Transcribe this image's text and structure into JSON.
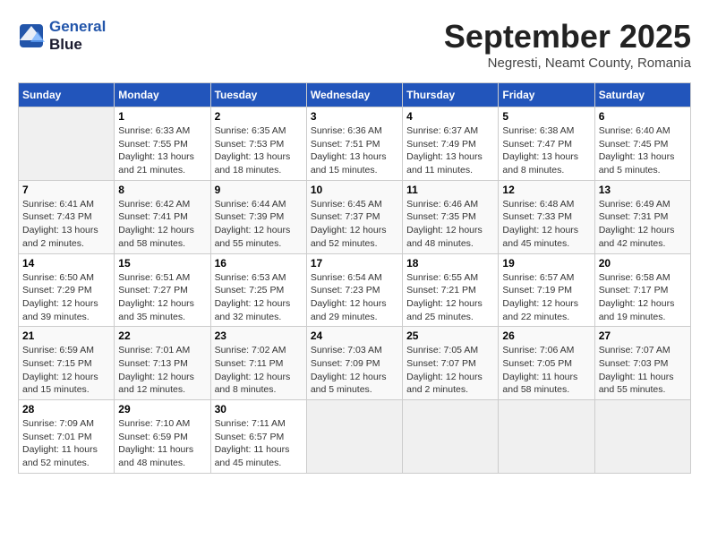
{
  "header": {
    "logo_line1": "General",
    "logo_line2": "Blue",
    "month_title": "September 2025",
    "location": "Negresti, Neamt County, Romania"
  },
  "weekdays": [
    "Sunday",
    "Monday",
    "Tuesday",
    "Wednesday",
    "Thursday",
    "Friday",
    "Saturday"
  ],
  "weeks": [
    [
      {
        "day": "",
        "sunrise": "",
        "sunset": "",
        "daylight": ""
      },
      {
        "day": "1",
        "sunrise": "Sunrise: 6:33 AM",
        "sunset": "Sunset: 7:55 PM",
        "daylight": "Daylight: 13 hours and 21 minutes."
      },
      {
        "day": "2",
        "sunrise": "Sunrise: 6:35 AM",
        "sunset": "Sunset: 7:53 PM",
        "daylight": "Daylight: 13 hours and 18 minutes."
      },
      {
        "day": "3",
        "sunrise": "Sunrise: 6:36 AM",
        "sunset": "Sunset: 7:51 PM",
        "daylight": "Daylight: 13 hours and 15 minutes."
      },
      {
        "day": "4",
        "sunrise": "Sunrise: 6:37 AM",
        "sunset": "Sunset: 7:49 PM",
        "daylight": "Daylight: 13 hours and 11 minutes."
      },
      {
        "day": "5",
        "sunrise": "Sunrise: 6:38 AM",
        "sunset": "Sunset: 7:47 PM",
        "daylight": "Daylight: 13 hours and 8 minutes."
      },
      {
        "day": "6",
        "sunrise": "Sunrise: 6:40 AM",
        "sunset": "Sunset: 7:45 PM",
        "daylight": "Daylight: 13 hours and 5 minutes."
      }
    ],
    [
      {
        "day": "7",
        "sunrise": "Sunrise: 6:41 AM",
        "sunset": "Sunset: 7:43 PM",
        "daylight": "Daylight: 13 hours and 2 minutes."
      },
      {
        "day": "8",
        "sunrise": "Sunrise: 6:42 AM",
        "sunset": "Sunset: 7:41 PM",
        "daylight": "Daylight: 12 hours and 58 minutes."
      },
      {
        "day": "9",
        "sunrise": "Sunrise: 6:44 AM",
        "sunset": "Sunset: 7:39 PM",
        "daylight": "Daylight: 12 hours and 55 minutes."
      },
      {
        "day": "10",
        "sunrise": "Sunrise: 6:45 AM",
        "sunset": "Sunset: 7:37 PM",
        "daylight": "Daylight: 12 hours and 52 minutes."
      },
      {
        "day": "11",
        "sunrise": "Sunrise: 6:46 AM",
        "sunset": "Sunset: 7:35 PM",
        "daylight": "Daylight: 12 hours and 48 minutes."
      },
      {
        "day": "12",
        "sunrise": "Sunrise: 6:48 AM",
        "sunset": "Sunset: 7:33 PM",
        "daylight": "Daylight: 12 hours and 45 minutes."
      },
      {
        "day": "13",
        "sunrise": "Sunrise: 6:49 AM",
        "sunset": "Sunset: 7:31 PM",
        "daylight": "Daylight: 12 hours and 42 minutes."
      }
    ],
    [
      {
        "day": "14",
        "sunrise": "Sunrise: 6:50 AM",
        "sunset": "Sunset: 7:29 PM",
        "daylight": "Daylight: 12 hours and 39 minutes."
      },
      {
        "day": "15",
        "sunrise": "Sunrise: 6:51 AM",
        "sunset": "Sunset: 7:27 PM",
        "daylight": "Daylight: 12 hours and 35 minutes."
      },
      {
        "day": "16",
        "sunrise": "Sunrise: 6:53 AM",
        "sunset": "Sunset: 7:25 PM",
        "daylight": "Daylight: 12 hours and 32 minutes."
      },
      {
        "day": "17",
        "sunrise": "Sunrise: 6:54 AM",
        "sunset": "Sunset: 7:23 PM",
        "daylight": "Daylight: 12 hours and 29 minutes."
      },
      {
        "day": "18",
        "sunrise": "Sunrise: 6:55 AM",
        "sunset": "Sunset: 7:21 PM",
        "daylight": "Daylight: 12 hours and 25 minutes."
      },
      {
        "day": "19",
        "sunrise": "Sunrise: 6:57 AM",
        "sunset": "Sunset: 7:19 PM",
        "daylight": "Daylight: 12 hours and 22 minutes."
      },
      {
        "day": "20",
        "sunrise": "Sunrise: 6:58 AM",
        "sunset": "Sunset: 7:17 PM",
        "daylight": "Daylight: 12 hours and 19 minutes."
      }
    ],
    [
      {
        "day": "21",
        "sunrise": "Sunrise: 6:59 AM",
        "sunset": "Sunset: 7:15 PM",
        "daylight": "Daylight: 12 hours and 15 minutes."
      },
      {
        "day": "22",
        "sunrise": "Sunrise: 7:01 AM",
        "sunset": "Sunset: 7:13 PM",
        "daylight": "Daylight: 12 hours and 12 minutes."
      },
      {
        "day": "23",
        "sunrise": "Sunrise: 7:02 AM",
        "sunset": "Sunset: 7:11 PM",
        "daylight": "Daylight: 12 hours and 8 minutes."
      },
      {
        "day": "24",
        "sunrise": "Sunrise: 7:03 AM",
        "sunset": "Sunset: 7:09 PM",
        "daylight": "Daylight: 12 hours and 5 minutes."
      },
      {
        "day": "25",
        "sunrise": "Sunrise: 7:05 AM",
        "sunset": "Sunset: 7:07 PM",
        "daylight": "Daylight: 12 hours and 2 minutes."
      },
      {
        "day": "26",
        "sunrise": "Sunrise: 7:06 AM",
        "sunset": "Sunset: 7:05 PM",
        "daylight": "Daylight: 11 hours and 58 minutes."
      },
      {
        "day": "27",
        "sunrise": "Sunrise: 7:07 AM",
        "sunset": "Sunset: 7:03 PM",
        "daylight": "Daylight: 11 hours and 55 minutes."
      }
    ],
    [
      {
        "day": "28",
        "sunrise": "Sunrise: 7:09 AM",
        "sunset": "Sunset: 7:01 PM",
        "daylight": "Daylight: 11 hours and 52 minutes."
      },
      {
        "day": "29",
        "sunrise": "Sunrise: 7:10 AM",
        "sunset": "Sunset: 6:59 PM",
        "daylight": "Daylight: 11 hours and 48 minutes."
      },
      {
        "day": "30",
        "sunrise": "Sunrise: 7:11 AM",
        "sunset": "Sunset: 6:57 PM",
        "daylight": "Daylight: 11 hours and 45 minutes."
      },
      {
        "day": "",
        "sunrise": "",
        "sunset": "",
        "daylight": ""
      },
      {
        "day": "",
        "sunrise": "",
        "sunset": "",
        "daylight": ""
      },
      {
        "day": "",
        "sunrise": "",
        "sunset": "",
        "daylight": ""
      },
      {
        "day": "",
        "sunrise": "",
        "sunset": "",
        "daylight": ""
      }
    ]
  ]
}
